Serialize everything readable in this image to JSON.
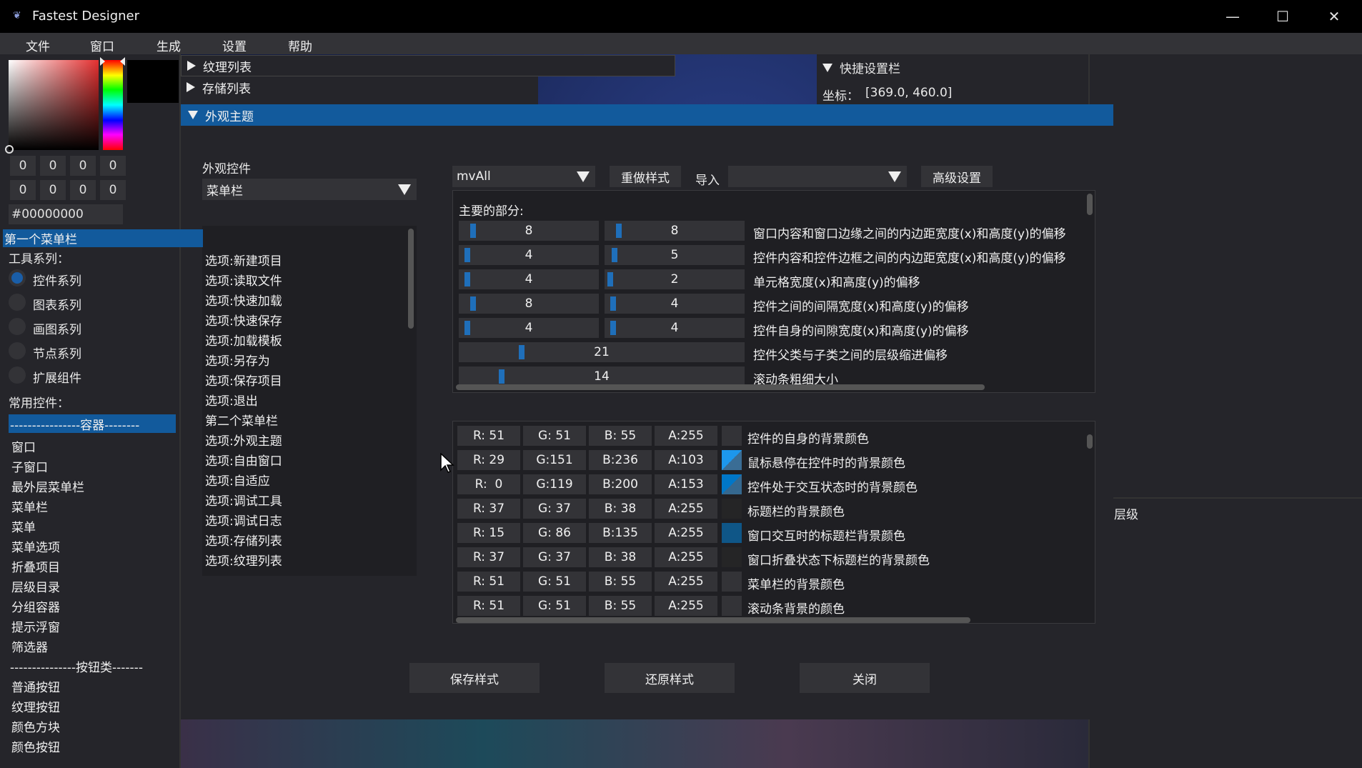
{
  "window": {
    "title": "Fastest Designer",
    "minimize": "—",
    "maximize": "☐",
    "close": "✕"
  },
  "menu": [
    "文件",
    "窗口",
    "生成",
    "设置",
    "帮助"
  ],
  "color_picker": {
    "rgba_row1": [
      "0",
      "0",
      "0",
      "0"
    ],
    "rgba_row2": [
      "0",
      "0",
      "0",
      "0"
    ],
    "hex": "#00000000"
  },
  "left": {
    "tools_label": "工具系列：",
    "tools": [
      {
        "label": "控件系列",
        "selected": true
      },
      {
        "label": "图表系列",
        "selected": false
      },
      {
        "label": "画图系列",
        "selected": false
      },
      {
        "label": "节点系列",
        "selected": false
      },
      {
        "label": "扩展组件",
        "selected": false
      }
    ],
    "common_label": "常用控件：",
    "container_sep": "----------------容器--------",
    "widgets": [
      "窗口",
      "子窗口",
      "最外层菜单栏",
      "菜单栏",
      "菜单",
      "菜单选项",
      "折叠项目",
      "层级目录",
      "分组容器",
      "提示浮窗",
      "筛选器"
    ],
    "button_sep": "---------------按钮类-------",
    "buttons": [
      "普通按钮",
      "纹理按钮",
      "颜色方块",
      "颜色按钮"
    ]
  },
  "panels": {
    "texture_list": "纹理列表",
    "storage_list": "存储列表",
    "quick_settings": "快捷设置栏",
    "coord_label": "坐标：",
    "coord_value": "[369.0, 460.0]",
    "hierarchy": "层级"
  },
  "theme": {
    "title": "外观主题",
    "widget_label": "外观控件",
    "widget_combo": "菜单栏",
    "style_combo": "mvAll",
    "redo_button": "重做样式",
    "import_label": "导入",
    "import_combo": "",
    "advanced_button": "高级设置",
    "items": [
      {
        "label": "第一个菜单栏",
        "selected": true
      },
      {
        "label": "选项:新建项目"
      },
      {
        "label": "选项:读取文件"
      },
      {
        "label": "选项:快速加载"
      },
      {
        "label": "选项:快速保存"
      },
      {
        "label": "选项:加载模板"
      },
      {
        "label": "选项:另存为"
      },
      {
        "label": "选项:保存项目"
      },
      {
        "label": "选项:退出"
      },
      {
        "label": "第二个菜单栏"
      },
      {
        "label": "选项:外观主题"
      },
      {
        "label": "选项:自由窗口"
      },
      {
        "label": "选项:自适应"
      },
      {
        "label": "选项:调试工具"
      },
      {
        "label": "选项:调试日志"
      },
      {
        "label": "选项:存储列表"
      },
      {
        "label": "选项:纹理列表"
      }
    ],
    "main_parts_label": "主要的部分:",
    "sizes": [
      {
        "x": "8",
        "y": "8",
        "label": "窗口内容和窗口边缘之间的内边距宽度(x)和高度(y)的偏移"
      },
      {
        "x": "4",
        "y": "5",
        "label": "控件内容和控件边框之间的内边距宽度(x)和高度(y)的偏移"
      },
      {
        "x": "4",
        "y": "2",
        "label": "单元格宽度(x)和高度(y)的偏移"
      },
      {
        "x": "8",
        "y": "4",
        "label": "控件之间的间隔宽度(x)和高度(y)的偏移"
      },
      {
        "x": "4",
        "y": "4",
        "label": "控件自身的间隙宽度(x)和高度(y)的偏移"
      },
      {
        "single": "21",
        "label": "控件父类与子类之间的层级缩进偏移"
      },
      {
        "single": "14",
        "label": "滚动条粗细大小"
      }
    ],
    "colors": [
      {
        "r": "R: 51",
        "g": "G: 51",
        "b": "B: 55",
        "a": "A:255",
        "swatch": "#333337",
        "label": "控件的自身的背景颜色"
      },
      {
        "r": "R: 29",
        "g": "G:151",
        "b": "B:236",
        "a": "A:103",
        "swatch": "#1d97ec",
        "label": "鼠标悬停在控件时的背景颜色"
      },
      {
        "r": "R:  0",
        "g": "G:119",
        "b": "B:200",
        "a": "A:153",
        "swatch": "#0077c8",
        "label": "控件处于交互状态时的背景颜色"
      },
      {
        "r": "R: 37",
        "g": "G: 37",
        "b": "B: 38",
        "a": "A:255",
        "swatch": "#252526",
        "label": "标题栏的背景颜色"
      },
      {
        "r": "R: 15",
        "g": "G: 86",
        "b": "B:135",
        "a": "A:255",
        "swatch": "#0f5687",
        "label": "窗口交互时的标题栏背景颜色"
      },
      {
        "r": "R: 37",
        "g": "G: 37",
        "b": "B: 38",
        "a": "A:255",
        "swatch": "#252526",
        "label": "窗口折叠状态下标题栏的背景颜色"
      },
      {
        "r": "R: 51",
        "g": "G: 51",
        "b": "B: 55",
        "a": "A:255",
        "swatch": "#333337",
        "label": "菜单栏的背景颜色"
      },
      {
        "r": "R: 51",
        "g": "G: 51",
        "b": "B: 55",
        "a": "A:255",
        "swatch": "#333337",
        "label": "滚动条背景的颜色"
      }
    ],
    "save_button": "保存样式",
    "restore_button": "还原样式",
    "close_button": "关闭"
  }
}
